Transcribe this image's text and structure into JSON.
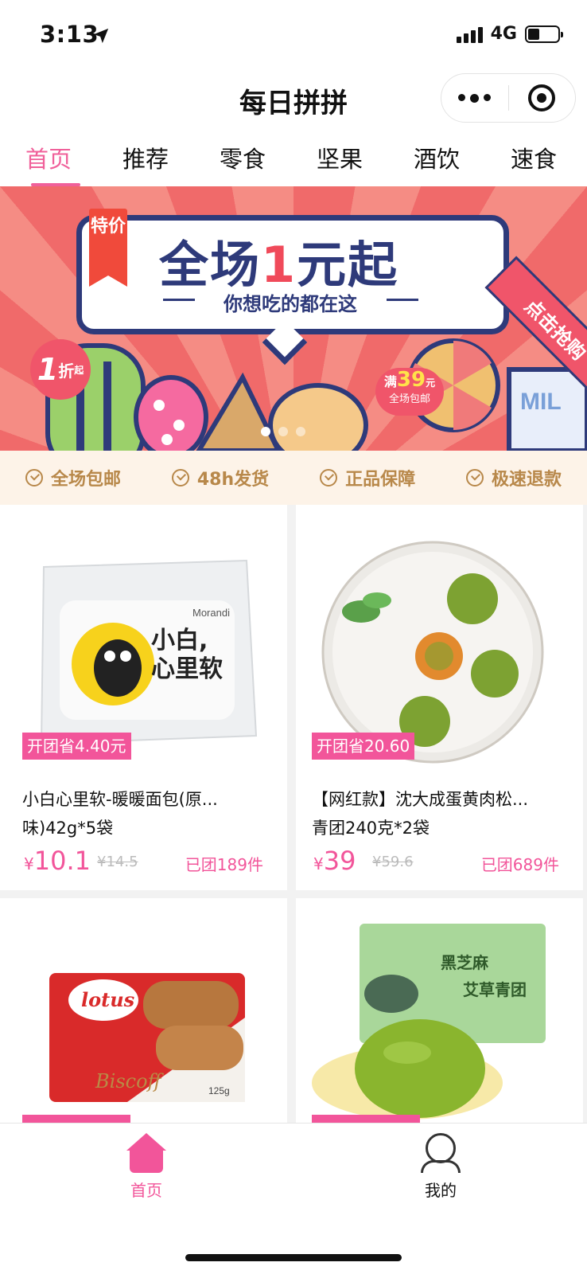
{
  "status": {
    "time": "3:13",
    "network": "4G",
    "battery_level": 0.4
  },
  "nav": {
    "title": "每日拼拼"
  },
  "tabs": [
    {
      "label": "首页",
      "active": true
    },
    {
      "label": "推荐"
    },
    {
      "label": "零食"
    },
    {
      "label": "坚果"
    },
    {
      "label": "酒饮"
    },
    {
      "label": "速食"
    }
  ],
  "banner": {
    "tag": "特价",
    "headline_pre": "全场",
    "headline_num": "1",
    "headline_post": "元起",
    "subline": "你想吃的都在这",
    "cta": "点击抢购",
    "discount_num": "1",
    "discount_unit": "折",
    "discount_suffix": "起",
    "free_ship_prefix": "满",
    "free_ship_value": "39",
    "free_ship_unit": "元",
    "free_ship_text": "全场包邮",
    "slide_count": 3,
    "active_slide": 1
  },
  "guarantees": [
    "全场包邮",
    "48h发货",
    "正品保障",
    "极速退款"
  ],
  "products": [
    {
      "badge": "开团省4.40元",
      "name": "小白心里软-暖暖面包(原...味)42g*5袋",
      "name_line1": "小白心里软-暖暖面包(原...",
      "name_line2": "味)42g*5袋",
      "currency": "¥",
      "price": "10.1",
      "orig": "¥14.5",
      "sold": "已团189件",
      "img_text_1": "小白,",
      "img_text_2": "心里软",
      "img_brand": "Morandi"
    },
    {
      "badge": "开团省20.60",
      "name": "【网红款】沈大成蛋黄肉松...青团240克*2袋",
      "name_line1": "【网红款】沈大成蛋黄肉松...",
      "name_line2": "青团240克*2袋",
      "currency": "¥",
      "price": "39",
      "orig": "¥59.6",
      "sold": "已团689件"
    },
    {
      "img_brand": "lotus",
      "img_sub": "Biscoff",
      "img_weight": "125g"
    },
    {
      "img_text_1": "黑芝麻",
      "img_text_2": "艾草青团"
    }
  ],
  "tabbar": [
    {
      "label": "首页",
      "icon": "home-icon",
      "active": true
    },
    {
      "label": "我的",
      "icon": "user-icon"
    }
  ],
  "colors": {
    "accent": "#f2559a",
    "banner_navy": "#2e3a7a",
    "guarantee_bg": "#fdf3e8",
    "guarantee_text": "#b8884a"
  }
}
